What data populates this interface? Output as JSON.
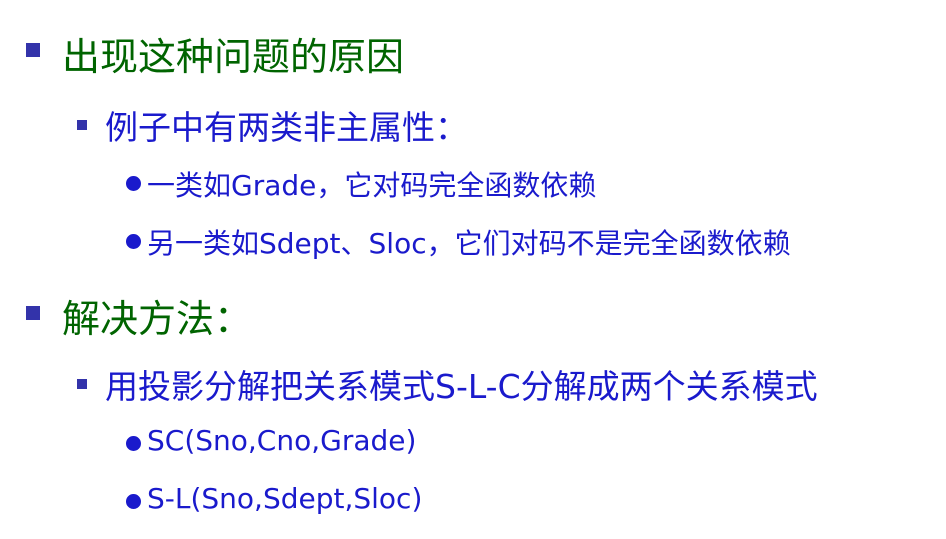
{
  "colors": {
    "level1_text": "#006400",
    "level2_text": "#1a1acc",
    "level3_text": "#1a1acc",
    "bullet": "#3333aa"
  },
  "sections": [
    {
      "heading": "出现这种问题的原因",
      "sub": {
        "text": "例子中有两类非主属性：",
        "items": [
          "一类如Grade，它对码完全函数依赖",
          "另一类如Sdept、Sloc，它们对码不是完全函数依赖"
        ]
      }
    },
    {
      "heading": "解决方法：",
      "sub": {
        "text": "用投影分解把关系模式S-L-C分解成两个关系模式",
        "items": [
          "SC(Sno,Cno,Grade)",
          "S-L(Sno,Sdept,Sloc)"
        ]
      }
    }
  ]
}
